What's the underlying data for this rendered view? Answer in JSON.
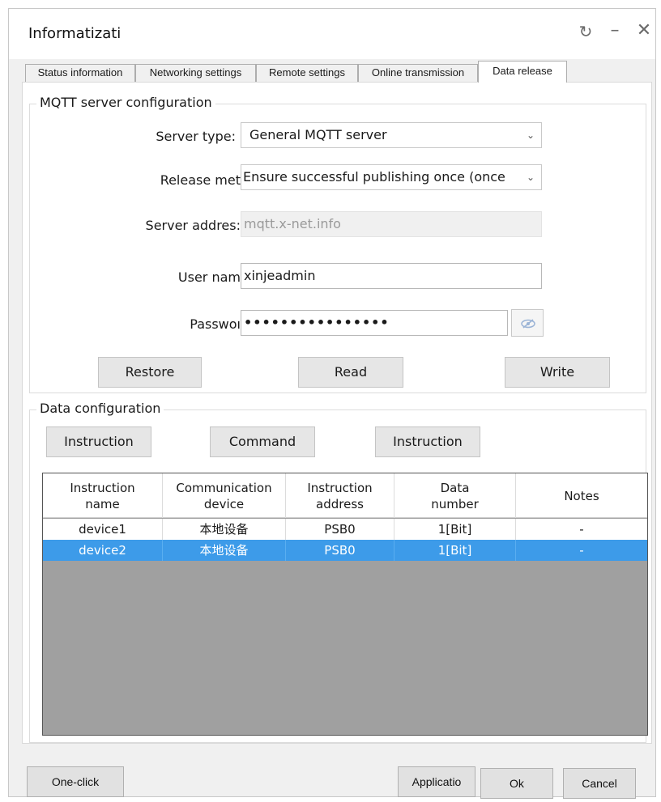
{
  "window": {
    "title": "Informatizati",
    "controls": [
      "refresh-icon",
      "minimize-icon",
      "close-icon"
    ]
  },
  "tabs": [
    {
      "label": "Status information",
      "active": false
    },
    {
      "label": "Networking settings",
      "active": false
    },
    {
      "label": "Remote settings",
      "active": false
    },
    {
      "label": "Online transmission",
      "active": false
    },
    {
      "label": "Data release",
      "active": true
    }
  ],
  "mqtt": {
    "legend": "MQTT server configuration",
    "server_type": {
      "label": "Server type:",
      "value": "General MQTT server"
    },
    "release_method": {
      "label": "Release met",
      "value": "Ensure successful publishing once (once"
    },
    "server_address": {
      "label": "Server addres:",
      "value": "mqtt.x-net.info"
    },
    "user_name": {
      "label": "User nam",
      "value": "xinjeadmin"
    },
    "password": {
      "label": "Passwoı",
      "value": "••••••••••••••••"
    },
    "buttons": {
      "restore": "Restore",
      "read": "Read",
      "write": "Write"
    }
  },
  "data_config": {
    "legend": "Data configuration",
    "buttons": [
      "Instruction",
      "Command",
      "Instruction"
    ],
    "columns": [
      [
        "Instruction",
        "name"
      ],
      [
        "Communication",
        "device"
      ],
      [
        "Instruction",
        "address"
      ],
      [
        "Data",
        "number"
      ],
      [
        "Notes"
      ]
    ],
    "rows": [
      {
        "name": "device1",
        "device": "本地设备",
        "address": "PSB0",
        "number": "1[Bit]",
        "notes": "-",
        "selected": false
      },
      {
        "name": "device2",
        "device": "本地设备",
        "address": "PSB0",
        "number": "1[Bit]",
        "notes": "-",
        "selected": true
      }
    ]
  },
  "footer": {
    "one_click": "One-click",
    "application": "Applicatio",
    "ok": "Ok",
    "cancel": "Cancel"
  },
  "colors": {
    "selection": "#3d9be9",
    "table_empty": "#a0a0a0",
    "dialog_bg": "#f0f0f0"
  }
}
